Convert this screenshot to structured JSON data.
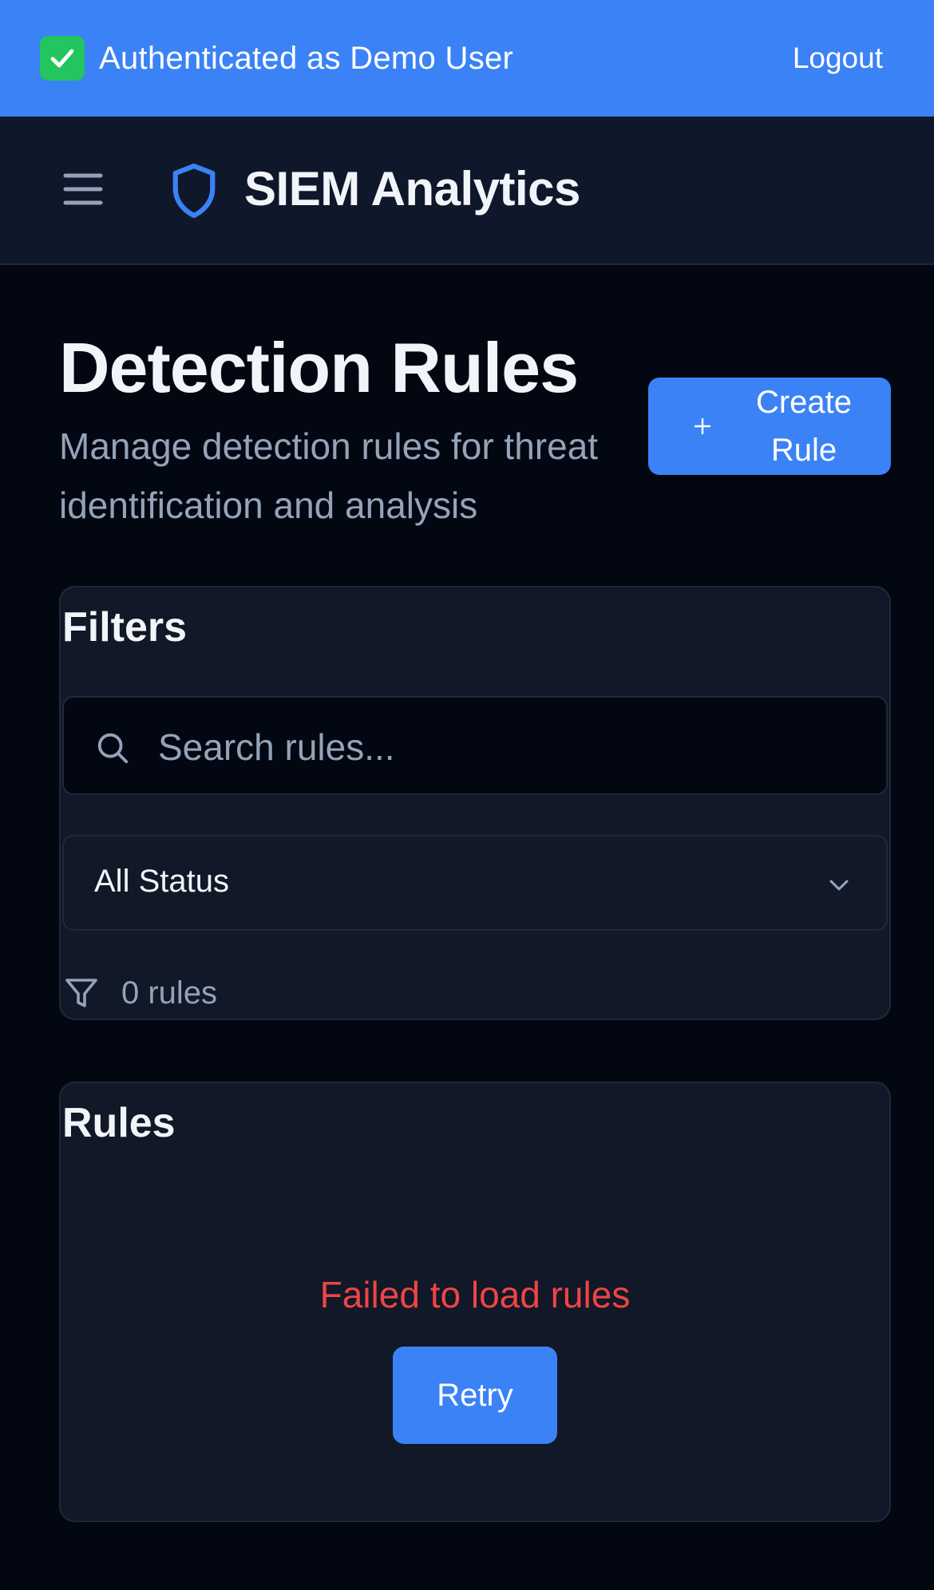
{
  "auth_banner": {
    "text": "Authenticated as Demo User",
    "logout_label": "Logout",
    "status_icon": "check-icon"
  },
  "header": {
    "app_title": "SIEM Analytics",
    "menu_icon": "hamburger-menu-icon",
    "logo_icon": "shield-icon"
  },
  "page": {
    "title": "Detection Rules",
    "subtitle": "Manage detection rules for threat identification and analysis",
    "create_button_label": "Create Rule",
    "create_button_icon": "plus-icon"
  },
  "filters": {
    "title": "Filters",
    "search_placeholder": "Search rules...",
    "search_value": "",
    "status_selected": "All Status",
    "rule_count_text": "0 rules"
  },
  "rules": {
    "title": "Rules",
    "error_message": "Failed to load rules",
    "retry_label": "Retry"
  },
  "colors": {
    "accent": "#3b82f6",
    "background": "#030712",
    "card": "#111827",
    "error": "#ef4444",
    "muted_text": "#94a3b8"
  }
}
